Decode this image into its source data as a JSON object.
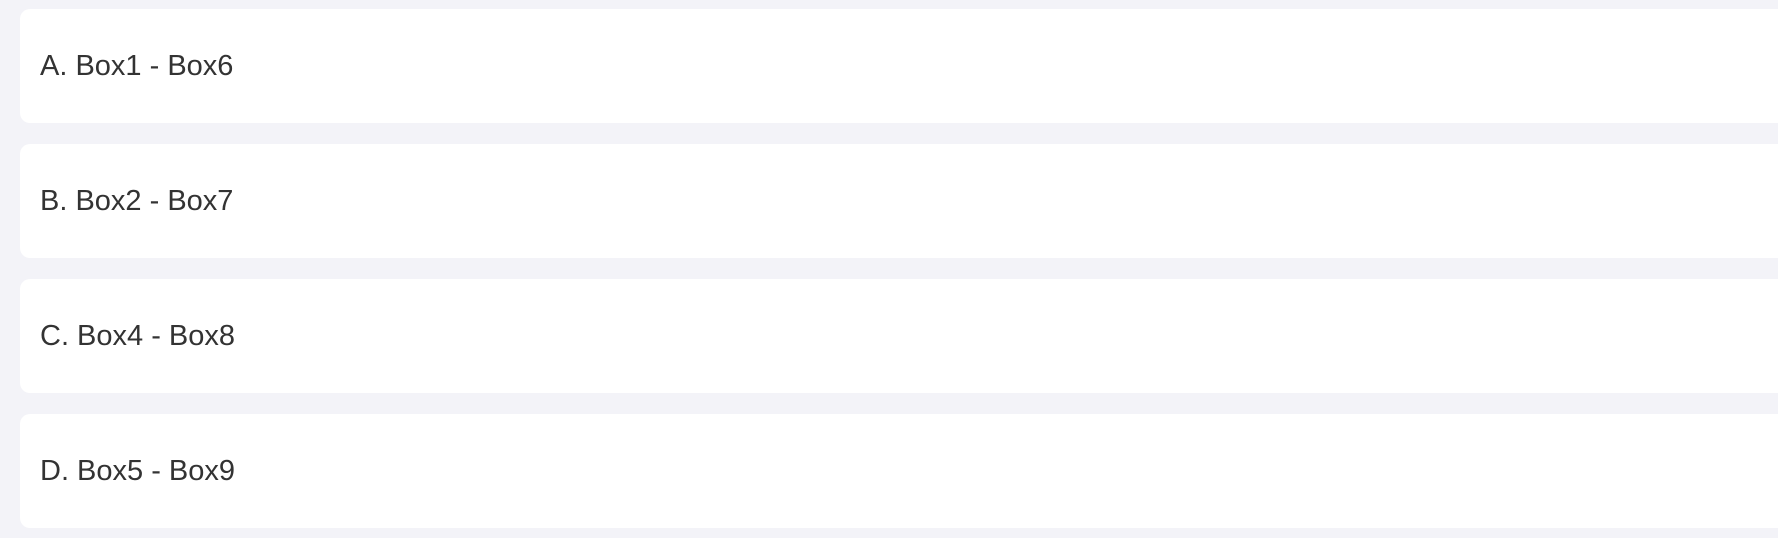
{
  "options": [
    {
      "label": "A. Box1 - Box6"
    },
    {
      "label": "B. Box2 - Box7"
    },
    {
      "label": "C. Box4 - Box8"
    },
    {
      "label": "D. Box5 - Box9"
    }
  ]
}
